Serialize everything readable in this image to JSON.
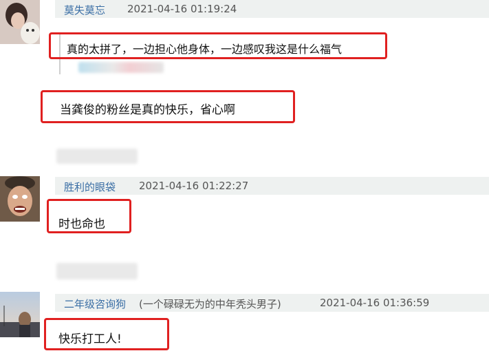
{
  "comments": [
    {
      "username": "莫失莫忘",
      "timestamp": "2021-04-16 01:19:24",
      "text": "真的太拼了，一边担心他身体，一边感叹我这是什么福气"
    },
    {
      "text": "当龚俊的粉丝是真的快乐，省心啊"
    },
    {
      "username": "胜利的眼袋",
      "timestamp": "2021-04-16 01:22:27",
      "text": "时也命也"
    },
    {
      "username": "二年级咨询狗",
      "user_note": "(一个碌碌无为的中年秃头男子)",
      "timestamp": "2021-04-16 01:36:59",
      "text": "快乐打工人!"
    }
  ],
  "colors": {
    "highlight": "#e02020",
    "username": "#3a6ea5",
    "header_bg": "#eef1f0"
  }
}
